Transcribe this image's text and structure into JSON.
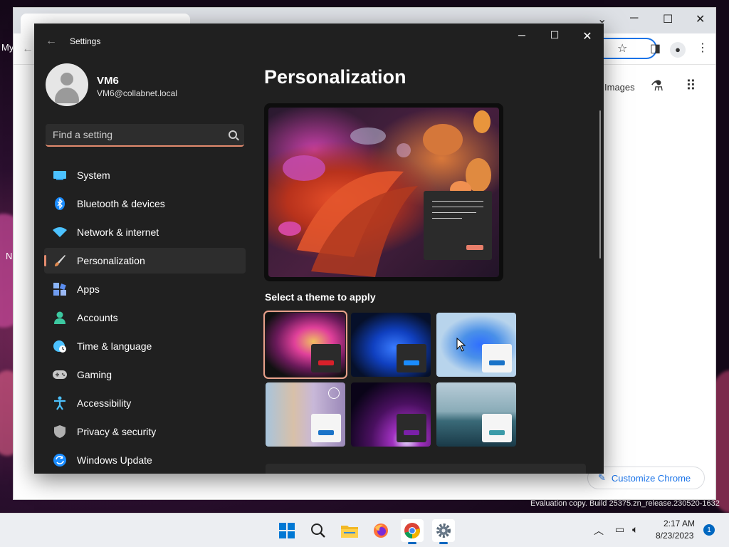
{
  "desktop": {
    "left_text_1": "My",
    "left_text_2": "N"
  },
  "chrome": {
    "images_link": "Images",
    "customize_label": "Customize Chrome",
    "minimize": "─",
    "maximize": "☐",
    "close": "✕"
  },
  "settings": {
    "window_title": "Settings",
    "user": {
      "name": "VM6",
      "email": "VM6@collabnet.local"
    },
    "search": {
      "placeholder": "Find a setting",
      "value": ""
    },
    "nav": [
      {
        "label": "System",
        "icon": "system-icon",
        "color": "#4cc2ff"
      },
      {
        "label": "Bluetooth & devices",
        "icon": "bluetooth-icon",
        "color": "#1a8cff"
      },
      {
        "label": "Network & internet",
        "icon": "wifi-icon",
        "color": "#4cc2ff"
      },
      {
        "label": "Personalization",
        "icon": "brush-icon",
        "color": "#e0a070",
        "active": true
      },
      {
        "label": "Apps",
        "icon": "apps-icon",
        "color": "#8ab4f8"
      },
      {
        "label": "Accounts",
        "icon": "accounts-icon",
        "color": "#3cc8a0"
      },
      {
        "label": "Time & language",
        "icon": "globe-icon",
        "color": "#4cc2ff"
      },
      {
        "label": "Gaming",
        "icon": "gamepad-icon",
        "color": "#c8c8c8"
      },
      {
        "label": "Accessibility",
        "icon": "accessibility-icon",
        "color": "#4cc2ff"
      },
      {
        "label": "Privacy & security",
        "icon": "shield-icon",
        "color": "#b0b0b0"
      },
      {
        "label": "Windows Update",
        "icon": "update-icon",
        "color": "#1a8cff"
      }
    ],
    "page_title": "Personalization",
    "theme_heading": "Select a theme to apply",
    "accent_color": "#e38b6e"
  },
  "watermark": "Evaluation copy. Build 25375.zn_release.230520-1632",
  "taskbar": {
    "time": "2:17 AM",
    "date": "8/23/2023",
    "notification_count": "1"
  }
}
